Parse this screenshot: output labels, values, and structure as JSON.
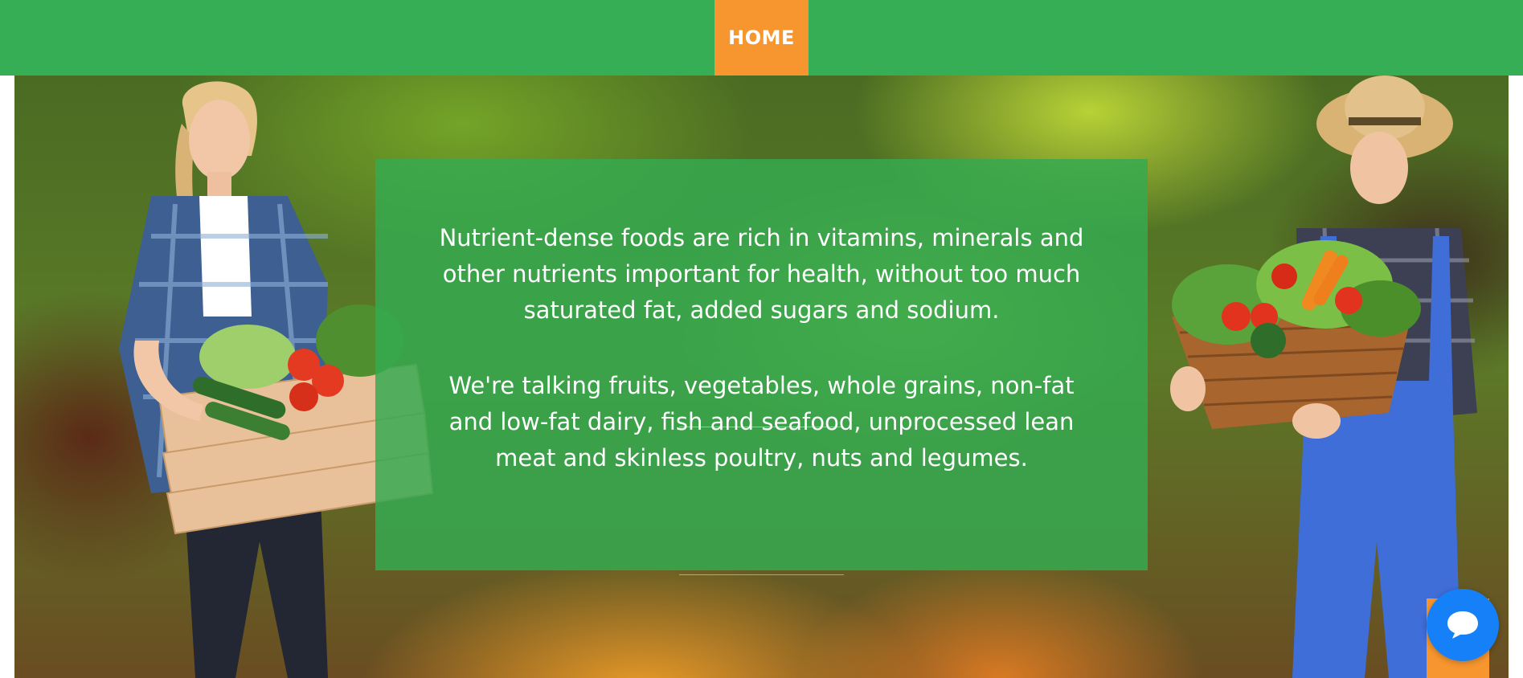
{
  "nav": {
    "items": [
      {
        "label": "HOME",
        "active": true
      }
    ],
    "bar_color": "#35ae55",
    "active_color": "#f7962f"
  },
  "hero": {
    "paragraph_1": "Nutrient-dense foods are rich in vitamins, minerals and other nutrients important for health, without too much saturated fat, added sugars and sodium.",
    "paragraph_2": "We're talking fruits, vegetables, whole grains, non-fat and low-fat dairy, fish and seafood, unprocessed lean meat and skinless poultry, nuts and legumes.",
    "panel_color": "#34aa50"
  },
  "chat": {
    "icon": "chat-bubble-icon",
    "color": "#1580f7"
  }
}
